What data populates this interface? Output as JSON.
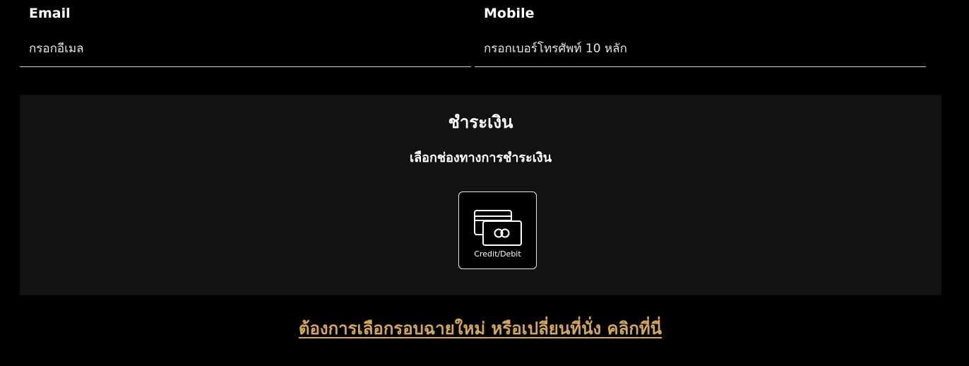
{
  "contact": {
    "email": {
      "label": "Email",
      "value": "",
      "placeholder": "กรอกอีเมล"
    },
    "mobile": {
      "label": "Mobile",
      "value": "",
      "placeholder": "กรอกเบอร์โทรศัพท์ 10 หลัก"
    }
  },
  "payment": {
    "title": "ชำระเงิน",
    "subtitle": "เลือกช่องทางการชำระเงิน",
    "methods": [
      {
        "label": "Credit/Debit",
        "icon": "credit-card-icon"
      }
    ]
  },
  "change_link": {
    "label": "ต้องการเลือกรอบฉายใหม่ หรือเปลี่ยนที่นั่ง คลิกที่นี่"
  },
  "colors": {
    "background": "#000000",
    "panel": "#121214",
    "link": "#d4a75a",
    "text": "#ffffff"
  }
}
